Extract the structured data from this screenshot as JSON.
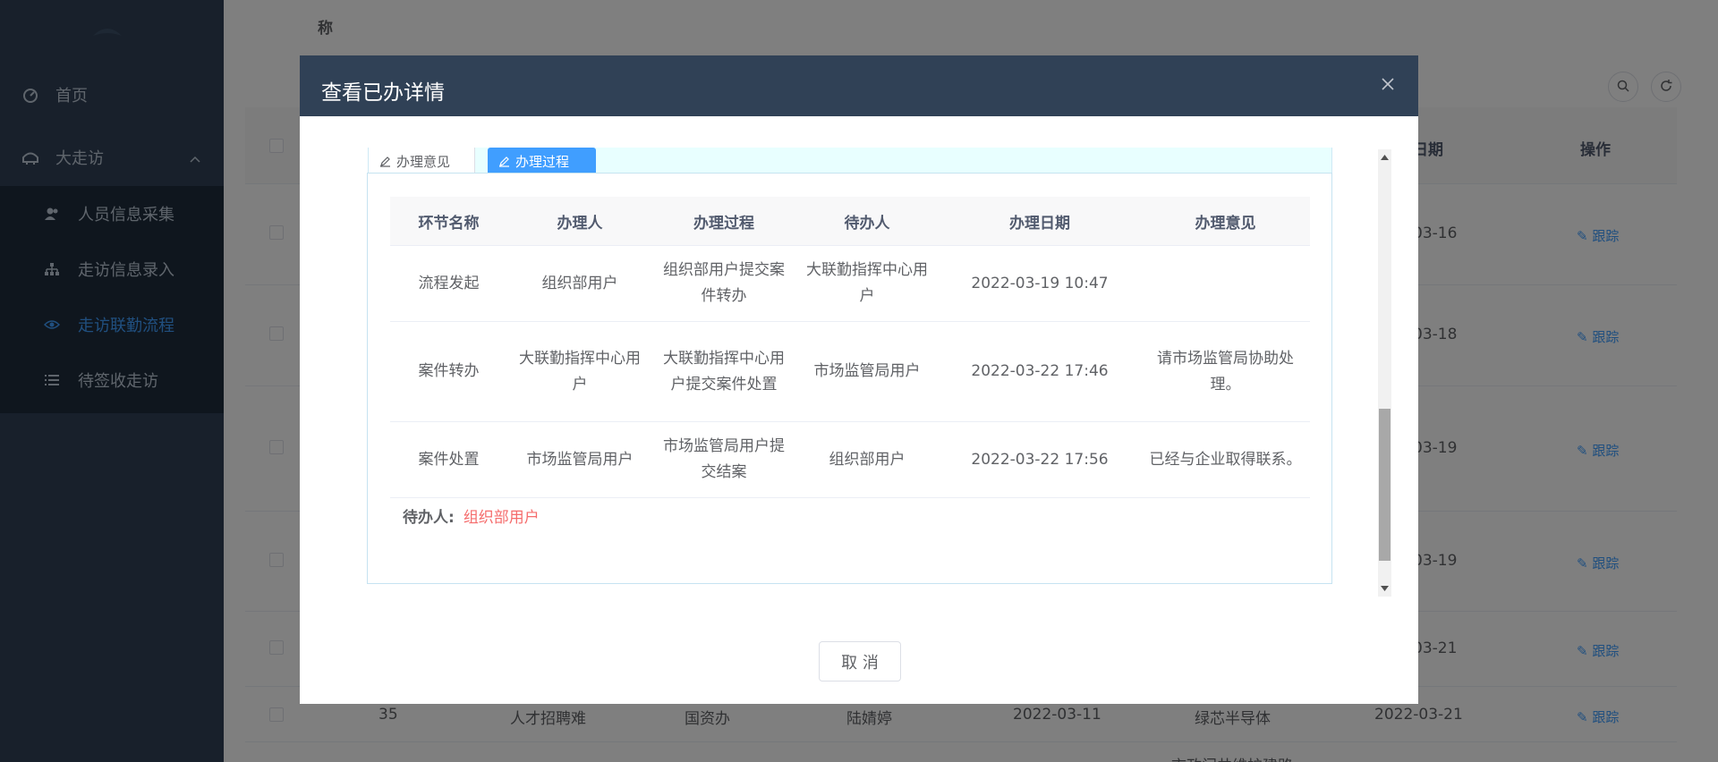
{
  "sidebar": {
    "items": [
      {
        "label": "首页",
        "icon": "dashboard-icon"
      },
      {
        "label": "大走访",
        "icon": "visit-icon"
      }
    ],
    "submenu": [
      {
        "label": "人员信息采集",
        "icon": "user-group-icon"
      },
      {
        "label": "走访信息录入",
        "icon": "sitemap-icon"
      },
      {
        "label": "走访联勤流程",
        "icon": "eye-icon",
        "active": true
      },
      {
        "label": "待签收走访",
        "icon": "list-icon"
      }
    ]
  },
  "background": {
    "top_label": "称",
    "head": {
      "date_col": "日期",
      "action_col": "操作"
    },
    "rows": [
      {
        "date": "03-16",
        "link": "跟踪"
      },
      {
        "date": "03-18",
        "link": "跟踪"
      },
      {
        "date": "03-19",
        "link": "跟踪"
      },
      {
        "date": "03-19",
        "link": "跟踪"
      },
      {
        "date": "03-21",
        "link": "跟踪"
      },
      {
        "no": "35",
        "issue": "人才招聘难",
        "dept": "国资办",
        "person": "陆婧婷",
        "visit_date": "2022-03-11",
        "company": "绿芯半导体",
        "date": "2022-03-21",
        "link": "跟踪"
      }
    ],
    "partial_text": "市政门井维护建路"
  },
  "modal": {
    "title": "查看已办详情",
    "tabs": [
      {
        "label": "办理意见"
      },
      {
        "label": "办理过程"
      }
    ],
    "table": {
      "headers": [
        "环节名称",
        "办理人",
        "办理过程",
        "待办人",
        "办理日期",
        "办理意见"
      ],
      "rows": [
        [
          "流程发起",
          "组织部用户",
          "组织部用户提交案件转办",
          "大联勤指挥中心用户",
          "2022-03-19 10:47",
          ""
        ],
        [
          "案件转办",
          "大联勤指挥中心用户",
          "大联勤指挥中心用户提交案件处置",
          "市场监管局用户",
          "2022-03-22 17:46",
          "请市场监管局协助处理。"
        ],
        [
          "案件处置",
          "市场监管局用户",
          "市场监管局用户提交结案",
          "组织部用户",
          "2022-03-22 17:56",
          "已经与企业取得联系。"
        ]
      ]
    },
    "pending": {
      "label": "待办人:",
      "value": "组织部用户"
    },
    "cancel_label": "取 消"
  }
}
